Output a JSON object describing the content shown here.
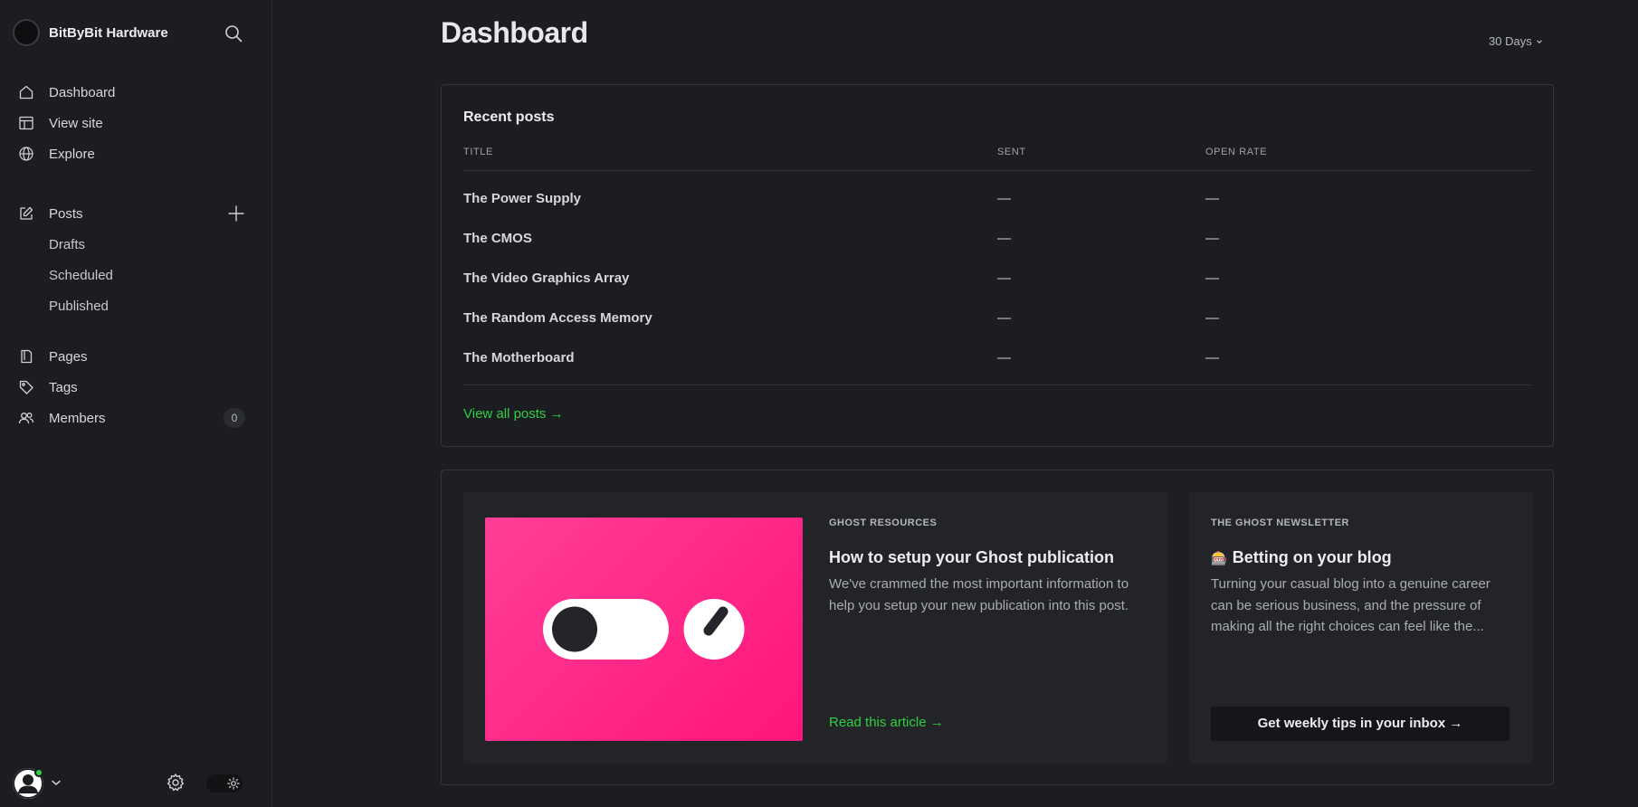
{
  "brand": {
    "name": "BitByBit Hardware"
  },
  "sidebar": {
    "items": [
      {
        "label": "Dashboard",
        "icon": "home-icon"
      },
      {
        "label": "View site",
        "icon": "layout-icon"
      },
      {
        "label": "Explore",
        "icon": "globe-icon"
      }
    ],
    "posts": {
      "label": "Posts",
      "sub": [
        "Drafts",
        "Scheduled",
        "Published"
      ]
    },
    "lower": [
      {
        "label": "Pages",
        "icon": "page-icon"
      },
      {
        "label": "Tags",
        "icon": "tag-icon"
      },
      {
        "label": "Members",
        "icon": "members-icon",
        "count": "0"
      }
    ]
  },
  "header": {
    "title": "Dashboard",
    "range": "30 Days"
  },
  "recent_posts": {
    "title": "Recent posts",
    "columns": [
      "TITLE",
      "SENT",
      "OPEN RATE"
    ],
    "rows": [
      {
        "title": "The Power Supply",
        "sent": "—",
        "open_rate": "—"
      },
      {
        "title": "The CMOS",
        "sent": "—",
        "open_rate": "—"
      },
      {
        "title": "The Video Graphics Array",
        "sent": "—",
        "open_rate": "—"
      },
      {
        "title": "The Random Access Memory",
        "sent": "—",
        "open_rate": "—"
      },
      {
        "title": "The Motherboard",
        "sent": "—",
        "open_rate": "—"
      }
    ],
    "view_all": "View all posts →"
  },
  "resources": {
    "eyebrow": "GHOST RESOURCES",
    "title": "How to setup your Ghost publication",
    "body": "We've crammed the most important information to help you setup your new publication into this post.",
    "link": "Read this article →"
  },
  "newsletter": {
    "eyebrow": "THE GHOST NEWSLETTER",
    "emoji": "🎰",
    "title": "Betting on your blog",
    "body": "Turning your casual blog into a genuine career can be serious business, and the pressure of making all the right choices can feel like the...",
    "button": "Get weekly tips in your inbox →"
  },
  "colors": {
    "accent": "#30cf43",
    "hero": "#ff2a88",
    "background": "#1c1d20"
  }
}
